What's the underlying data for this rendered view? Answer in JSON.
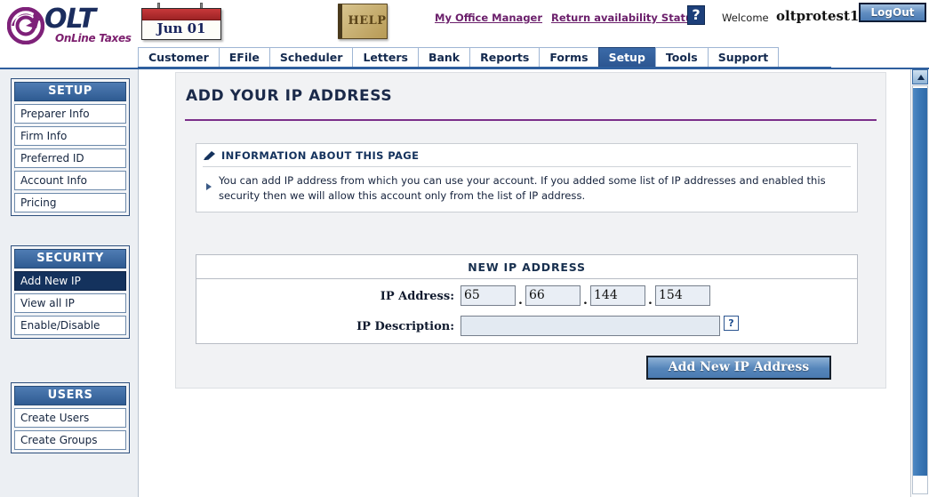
{
  "brand": {
    "logo_main": "OLT",
    "logo_sub": "OnLine Taxes",
    "logo_icon": "olt-swirl-logo"
  },
  "header": {
    "calendar_date": "Jun 01",
    "help_label": "HELP",
    "links": [
      {
        "label": "My Office Manager",
        "name": "my-office-manager-link"
      },
      {
        "label": "Return availability Status",
        "name": "return-availability-status-link"
      }
    ],
    "help_qmark": "?",
    "welcome_label": "Welcome",
    "welcome_user": "oltprotest1",
    "logout_label": "LogOut"
  },
  "nav": {
    "tabs": [
      {
        "label": "Customer",
        "active": false
      },
      {
        "label": "EFile",
        "active": false
      },
      {
        "label": "Scheduler",
        "active": false
      },
      {
        "label": "Letters",
        "active": false
      },
      {
        "label": "Bank",
        "active": false
      },
      {
        "label": "Reports",
        "active": false
      },
      {
        "label": "Forms",
        "active": false
      },
      {
        "label": "Setup",
        "active": true
      },
      {
        "label": "Tools",
        "active": false
      },
      {
        "label": "Support",
        "active": false
      }
    ]
  },
  "sidebar": {
    "panels": [
      {
        "title": "SETUP",
        "items": [
          {
            "label": "Preparer Info",
            "selected": false
          },
          {
            "label": "Firm Info",
            "selected": false
          },
          {
            "label": "Preferred ID",
            "selected": false
          },
          {
            "label": "Account Info",
            "selected": false
          },
          {
            "label": "Pricing",
            "selected": false
          }
        ]
      },
      {
        "title": "SECURITY",
        "items": [
          {
            "label": "Add New IP",
            "selected": true
          },
          {
            "label": "View all IP",
            "selected": false
          },
          {
            "label": "Enable/Disable",
            "selected": false
          }
        ]
      },
      {
        "title": "USERS",
        "items": [
          {
            "label": "Create Users",
            "selected": false
          },
          {
            "label": "Create Groups",
            "selected": false
          }
        ]
      }
    ]
  },
  "main": {
    "page_title": "ADD YOUR IP ADDRESS",
    "info_box": {
      "heading": "INFORMATION ABOUT THIS PAGE",
      "body": "You can add IP address from which you can use your account. If you added some list of IP addresses and enabled this security then we will allow this account only from the list of IP address."
    },
    "ip_panel": {
      "heading": "NEW IP ADDRESS",
      "ip_label": "IP Address:",
      "octets": [
        "65",
        "66",
        "144",
        "154"
      ],
      "separator": ".",
      "description_label": "IP Description:",
      "description_value": "",
      "description_help": "?"
    },
    "submit_label": "Add New IP Address"
  },
  "scrollbar": {
    "up_arrow": "scroll-up-arrow"
  },
  "colors": {
    "nav_active": "#2c5691",
    "panel_head": "#2f5b92",
    "selected_item": "#14325d",
    "title_rule": "#7b2f8a",
    "link": "#6b1f6b",
    "scroll_thumb": "#3d7ab8"
  }
}
